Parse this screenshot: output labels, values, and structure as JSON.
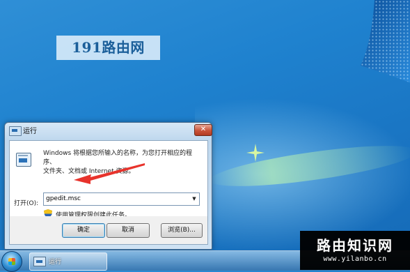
{
  "watermark_top": "191路由网",
  "dialog": {
    "title": "运行",
    "close_symbol": "✕",
    "description_line1": "Windows 将根据您所输入的名称，为您打开相应的程序、",
    "description_line2": "文件夹、文档或 Internet 资源。",
    "open_label": "打开(O):",
    "input_value": "gpedit.msc",
    "admin_note": "使用管理权限创建此任务。",
    "buttons": {
      "ok": "确定",
      "cancel": "取消",
      "browse": "浏览(B)..."
    }
  },
  "taskbar": {
    "running_app_label": "运行"
  },
  "watermark_br": {
    "title": "路由知识网",
    "url": "www.yilanbo.cn"
  },
  "colors": {
    "desktop": "#1f82cf",
    "arrow": "#e8332c",
    "close_button": "#c9543a"
  },
  "icons": [
    "run-icon",
    "close-icon",
    "uac-shield-icon",
    "dropdown-arrow-icon",
    "windows-start-icon"
  ]
}
